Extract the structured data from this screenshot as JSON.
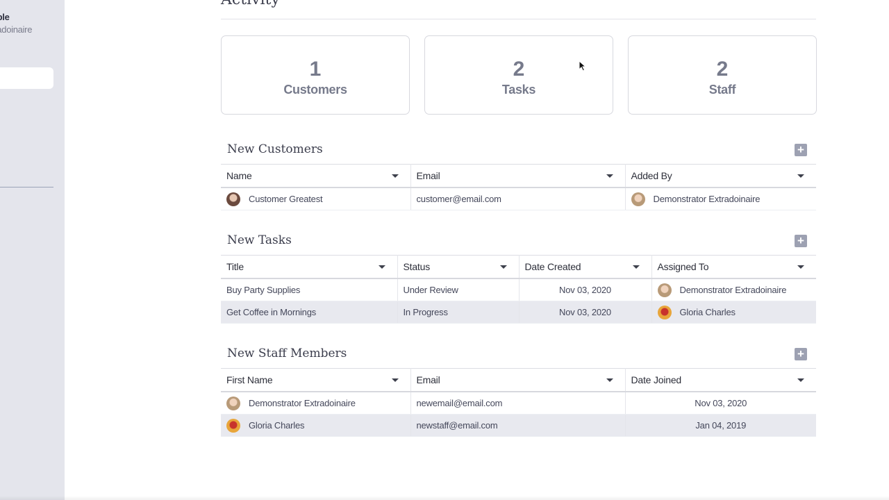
{
  "sidebar": {
    "user_name": "ople",
    "user_role": "tradoinaire"
  },
  "page": {
    "title": "Activity"
  },
  "stats": [
    {
      "value": "1",
      "label": "Customers"
    },
    {
      "value": "2",
      "label": "Tasks"
    },
    {
      "value": "2",
      "label": "Staff"
    }
  ],
  "new_customers": {
    "title": "New Customers",
    "columns": [
      "Name",
      "Email",
      "Added By"
    ],
    "rows": [
      {
        "name": "Customer Greatest",
        "email": "customer@email.com",
        "added_by": "Demonstrator Extradoinaire"
      }
    ]
  },
  "new_tasks": {
    "title": "New Tasks",
    "columns": [
      "Title",
      "Status",
      "Date Created",
      "Assigned To"
    ],
    "rows": [
      {
        "title": "Buy Party Supplies",
        "status": "Under Review",
        "date": "Nov 03, 2020",
        "assigned": "Demonstrator Extradoinaire"
      },
      {
        "title": "Get Coffee in Mornings",
        "status": "In Progress",
        "date": "Nov 03, 2020",
        "assigned": "Gloria Charles"
      }
    ]
  },
  "new_staff": {
    "title": "New Staff Members",
    "columns": [
      "First Name",
      "Email",
      "Date Joined"
    ],
    "rows": [
      {
        "name": "Demonstrator Extradoinaire",
        "email": "newemail@email.com",
        "date": "Nov 03, 2020"
      },
      {
        "name": "Gloria Charles",
        "email": "newstaff@email.com",
        "date": "Jan 04, 2019"
      }
    ]
  },
  "icons": {
    "add": "plus-icon",
    "sort": "caret-down-icon"
  },
  "colors": {
    "sidebar_bg": "#e4e5ec",
    "stat_text": "#767a8b",
    "alt_row": "#e8e9ef",
    "add_button": "#9da1b2"
  }
}
